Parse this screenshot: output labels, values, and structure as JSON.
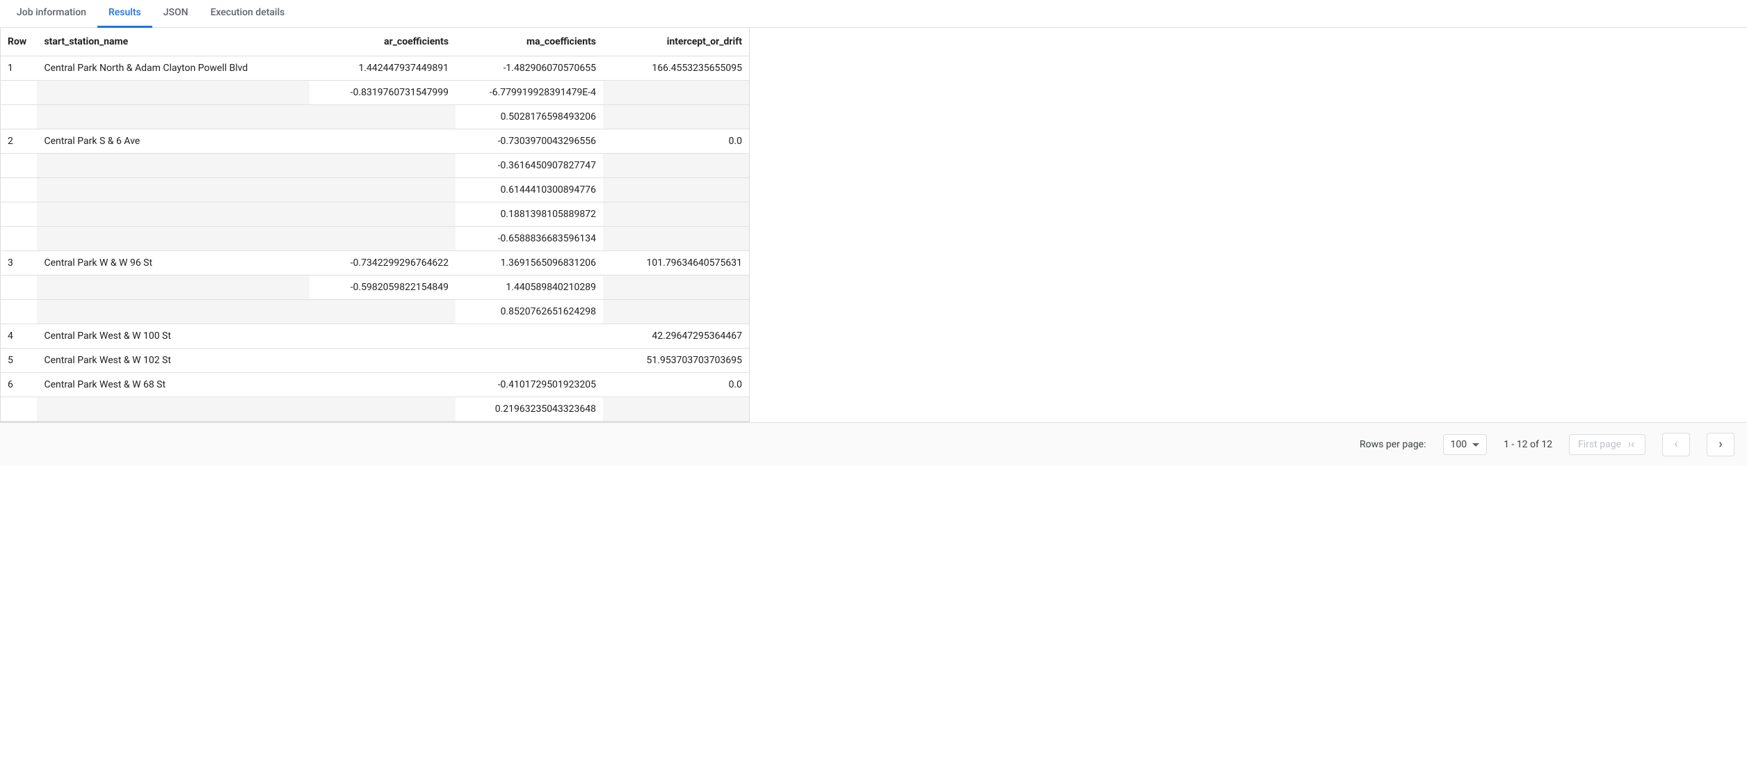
{
  "tabs": [
    {
      "label": "Job information",
      "active": false
    },
    {
      "label": "Results",
      "active": true
    },
    {
      "label": "JSON",
      "active": false
    },
    {
      "label": "Execution details",
      "active": false
    }
  ],
  "columns": {
    "row": "Row",
    "name": "start_station_name",
    "ar": "ar_coefficients",
    "ma": "ma_coefficients",
    "intercept": "intercept_or_drift"
  },
  "rows": [
    {
      "row": "1",
      "name": "Central Park North & Adam Clayton Powell Blvd",
      "ar": [
        "1.442447937449891",
        "-0.8319760731547999",
        ""
      ],
      "ma": [
        "-1.482906070570655",
        "-6.779919928391479E-4",
        "0.5028176598493206"
      ],
      "intercept": "166.4553235655095"
    },
    {
      "row": "2",
      "name": "Central Park S & 6 Ave",
      "ar": [
        "",
        "",
        "",
        "",
        ""
      ],
      "ma": [
        "-0.7303970043296556",
        "-0.3616450907827747",
        "0.6144410300894776",
        "0.1881398105889872",
        "-0.6588836683596134"
      ],
      "intercept": "0.0"
    },
    {
      "row": "3",
      "name": "Central Park W & W 96 St",
      "ar": [
        "-0.7342299296764622",
        "-0.5982059822154849",
        ""
      ],
      "ma": [
        "1.3691565096831206",
        "1.440589840210289",
        "0.8520762651624298"
      ],
      "intercept": "101.79634640575631"
    },
    {
      "row": "4",
      "name": "Central Park West & W 100 St",
      "ar": [
        ""
      ],
      "ma": [
        ""
      ],
      "intercept": "42.29647295364467"
    },
    {
      "row": "5",
      "name": "Central Park West & W 102 St",
      "ar": [
        ""
      ],
      "ma": [
        ""
      ],
      "intercept": "51.953703703703695"
    },
    {
      "row": "6",
      "name": "Central Park West & W 68 St",
      "ar": [
        "",
        ""
      ],
      "ma": [
        "-0.4101729501923205",
        "0.21963235043323648"
      ],
      "intercept": "0.0"
    }
  ],
  "footer": {
    "rows_per_page_label": "Rows per page:",
    "rows_per_page_value": "100",
    "range": "1 - 12 of 12",
    "first_page": "First page"
  }
}
